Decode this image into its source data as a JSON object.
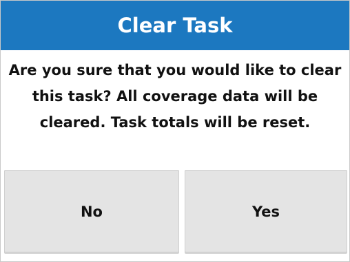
{
  "dialog": {
    "title": "Clear Task",
    "message": "Are you sure that you would like to clear this task? All coverage data will be cleared. Task totals will be reset.",
    "no_label": "No",
    "yes_label": "Yes"
  },
  "colors": {
    "title_bar": "#1c78c0",
    "title_text": "#ffffff",
    "button_bg": "#e4e4e4",
    "text": "#111111"
  }
}
